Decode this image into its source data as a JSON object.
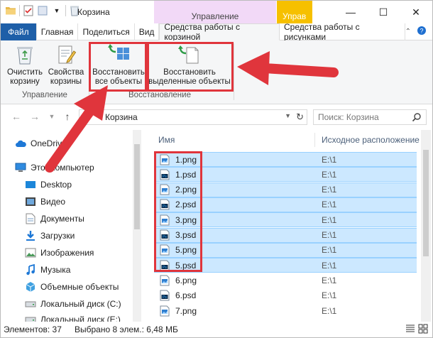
{
  "window": {
    "title": "Корзина"
  },
  "context_tabs": {
    "manage1": "Управление",
    "manage2": "Управ"
  },
  "ribbon_tabs": [
    "Файл",
    "Главная",
    "Поделиться",
    "Вид",
    "Средства работы с корзиной",
    "Средства работы с рисунками"
  ],
  "ribbon": {
    "empty_bin": "Очистить корзину",
    "bin_props": "Свойства корзины",
    "restore_all": "Восстановить все объекты",
    "restore_selected": "Восстановить выделенные объекты",
    "group_manage": "Управление",
    "group_restore": "Восстановление"
  },
  "address": {
    "path": "Корзина",
    "search_placeholder": "Поиск: Корзина"
  },
  "nav": {
    "items": [
      "OneDrive",
      "Этот компьютер",
      "Desktop",
      "Видео",
      "Документы",
      "Загрузки",
      "Изображения",
      "Музыка",
      "Объемные объекты",
      "Локальный диск (C:)",
      "Локальный диск (E:)"
    ]
  },
  "columns": {
    "name": "Имя",
    "origin": "Исходное расположение"
  },
  "files": [
    {
      "name": "1.png",
      "type": "png",
      "origin": "E:\\1",
      "selected": true
    },
    {
      "name": "1.psd",
      "type": "psd",
      "origin": "E:\\1",
      "selected": true
    },
    {
      "name": "2.png",
      "type": "png",
      "origin": "E:\\1",
      "selected": true
    },
    {
      "name": "2.psd",
      "type": "psd",
      "origin": "E:\\1",
      "selected": true
    },
    {
      "name": "3.png",
      "type": "png",
      "origin": "E:\\1",
      "selected": true
    },
    {
      "name": "3.psd",
      "type": "psd",
      "origin": "E:\\1",
      "selected": true
    },
    {
      "name": "5.png",
      "type": "png",
      "origin": "E:\\1",
      "selected": true
    },
    {
      "name": "5.psd",
      "type": "psd",
      "origin": "E:\\1",
      "selected": true
    },
    {
      "name": "6.png",
      "type": "png",
      "origin": "E:\\1",
      "selected": false
    },
    {
      "name": "6.psd",
      "type": "psd",
      "origin": "E:\\1",
      "selected": false
    },
    {
      "name": "7.png",
      "type": "png",
      "origin": "E:\\1",
      "selected": false
    }
  ],
  "status": {
    "count": "Элементов: 37",
    "selection": "Выбрано 8 элем.: 6,48 МБ"
  },
  "colors": {
    "accent": "#1e5fa8",
    "selection": "#cce8ff",
    "highlight": "#e0353c",
    "context1": "#f2d9f7",
    "context2": "#f6c000"
  }
}
